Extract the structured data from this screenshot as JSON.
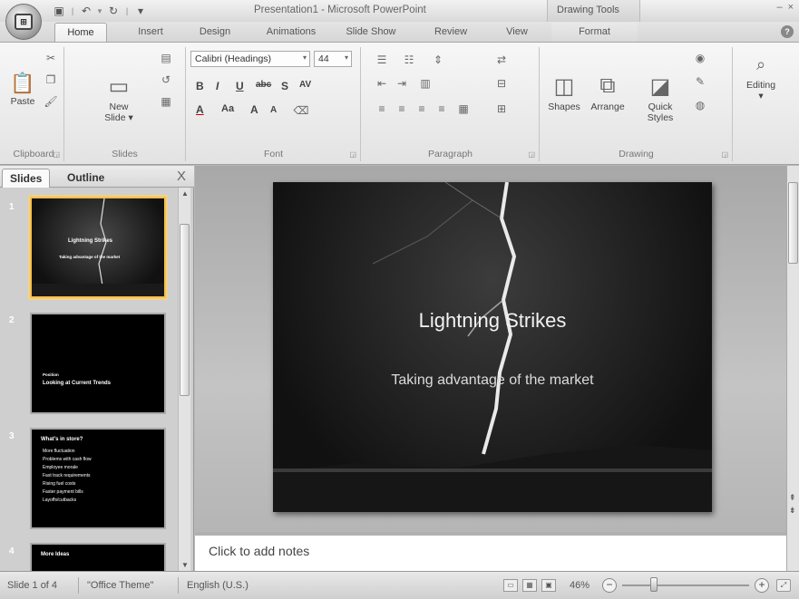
{
  "window": {
    "title": "Presentation1 - Microsoft PowerPoint",
    "context_tab_group": "Drawing Tools",
    "office_button_label": "Office Button"
  },
  "tabs": [
    "Home",
    "Insert",
    "Design",
    "Animations",
    "Slide Show",
    "Review",
    "View",
    "Format"
  ],
  "ribbon": {
    "clipboard": {
      "label": "Clipboard",
      "paste": "Paste"
    },
    "slides": {
      "label": "Slides",
      "new_slide_1": "New",
      "new_slide_2": "Slide"
    },
    "font": {
      "label": "Font",
      "font_name": "Calibri (Headings)",
      "font_size": "44",
      "bold": "B",
      "italic": "I",
      "underline": "U",
      "strike": "abc",
      "shadow": "S",
      "spacing": "AV",
      "color": "A",
      "change_case": "Aa",
      "grow": "A",
      "shrink": "A"
    },
    "paragraph": {
      "label": "Paragraph"
    },
    "drawing": {
      "label": "Drawing",
      "shapes": "Shapes",
      "arrange": "Arrange",
      "quick_styles_1": "Quick",
      "quick_styles_2": "Styles"
    },
    "editing": {
      "label": "Editing"
    }
  },
  "pane": {
    "tabs": [
      "Slides",
      "Outline"
    ],
    "close": "X",
    "thumbnails": [
      {
        "num": "1",
        "title": "Lightning Strikes",
        "subtitle": "Taking advantage of the market"
      },
      {
        "num": "2",
        "kicker": "Position",
        "title": "Looking at Current Trends"
      },
      {
        "num": "3",
        "title": "What's in store?",
        "bullets": [
          "More fluctuation",
          "Problems with cash flow",
          "Employee morale",
          "Fast track requirements",
          "Rising fuel costs",
          "Faster payment bills",
          "Layoffs/cutbacks"
        ]
      },
      {
        "num": "4",
        "title": "More Ideas"
      }
    ]
  },
  "slide": {
    "title": "Lightning Strikes",
    "subtitle": "Taking advantage of the market"
  },
  "notes": {
    "placeholder": "Click to add notes"
  },
  "status": {
    "slide_pos": "Slide 1 of 4",
    "theme": "\"Office Theme\"",
    "language": "English (U.S.)",
    "zoom": "46%",
    "zoom_fraction": 0.25
  }
}
